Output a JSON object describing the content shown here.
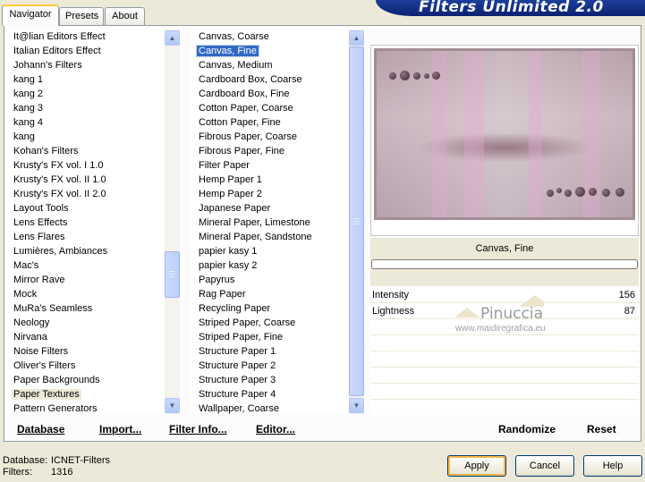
{
  "tabs": [
    {
      "label": "Navigator",
      "active": true
    },
    {
      "label": "Presets",
      "active": false
    },
    {
      "label": "About",
      "active": false
    }
  ],
  "banner_title": "Filters Unlimited 2.0",
  "categories": {
    "items": [
      "It@lian Editors Effect",
      "Italian Editors Effect",
      "Johann's Filters",
      "kang 1",
      "kang 2",
      "kang 3",
      "kang 4",
      "kang",
      "Kohan's Filters",
      "Krusty's FX vol. I 1.0",
      "Krusty's FX vol. II 1.0",
      "Krusty's FX vol. II 2.0",
      "Layout Tools",
      "Lens Effects",
      "Lens Flares",
      "Lumières, Ambiances",
      "Mac's",
      "Mirror Rave",
      "Mock",
      "MuRa's Seamless",
      "Neology",
      "Nirvana",
      "Noise Filters",
      "Oliver's Filters",
      "Paper Backgrounds",
      "Paper Textures",
      "Pattern Generators"
    ],
    "selected_index": 25
  },
  "filters": {
    "items": [
      "Canvas, Coarse",
      "Canvas, Fine",
      "Canvas, Medium",
      "Cardboard Box, Coarse",
      "Cardboard Box, Fine",
      "Cotton Paper, Coarse",
      "Cotton Paper, Fine",
      "Fibrous Paper, Coarse",
      "Fibrous Paper, Fine",
      "Filter Paper",
      "Hemp Paper 1",
      "Hemp Paper 2",
      "Japanese Paper",
      "Mineral Paper, Limestone",
      "Mineral Paper, Sandstone",
      "papier kasy 1",
      "papier kasy 2",
      "Papyrus",
      "Rag Paper",
      "Recycling Paper",
      "Striped Paper, Coarse",
      "Striped Paper, Fine",
      "Structure Paper 1",
      "Structure Paper 2",
      "Structure Paper 3",
      "Structure Paper 4",
      "Wallpaper, Coarse"
    ],
    "selected_index": 1
  },
  "links": {
    "database": "Database",
    "import": "Import...",
    "filter_info": "Filter Info...",
    "editor": "Editor...",
    "randomize": "Randomize",
    "reset": "Reset"
  },
  "preview": {
    "filter_name": "Canvas, Fine"
  },
  "params": [
    {
      "label": "Intensity",
      "value": "156"
    },
    {
      "label": "Lightness",
      "value": "87"
    }
  ],
  "watermark": {
    "name": "Pinuccia",
    "url": "www.maidiregrafica.eu"
  },
  "status": {
    "database_label": "Database:",
    "database_value": "ICNET-Filters",
    "filters_label": "Filters:",
    "filters_value": "1316"
  },
  "buttons": {
    "apply": "Apply",
    "cancel": "Cancel",
    "help": "Help"
  },
  "colors": {
    "selection_blue": "#316ac5",
    "dialog_bg": "#ece9d8",
    "banner_blue": "#0b2170"
  }
}
